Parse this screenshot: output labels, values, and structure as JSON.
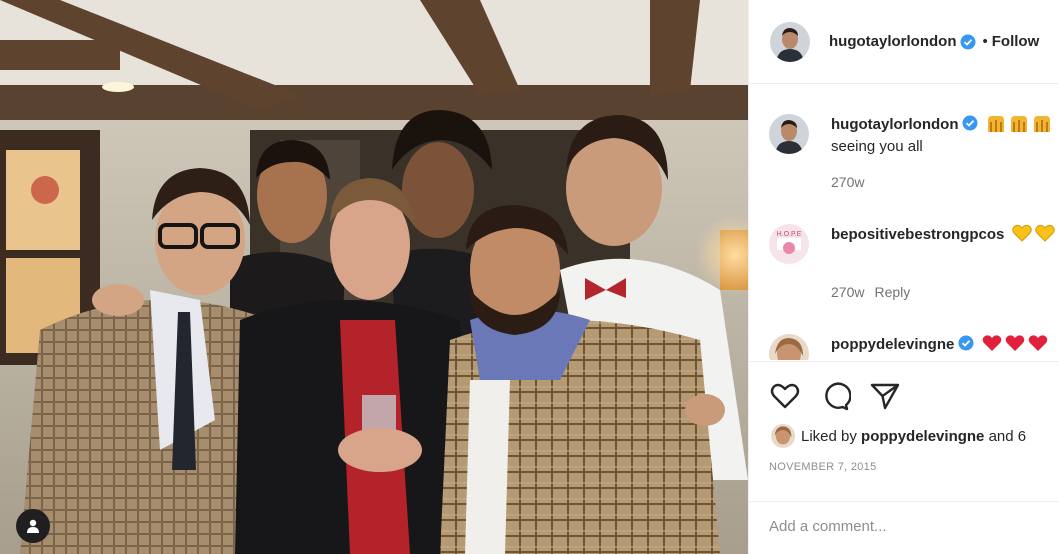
{
  "post": {
    "author": "hugotaylorlondon",
    "follow_label": "Follow",
    "separator": "•"
  },
  "comments": [
    {
      "user": "hugotaylorlondon",
      "verified": true,
      "emojis": [
        "hands-icon",
        "hands-icon",
        "hands-icon"
      ],
      "text": "seeing you all",
      "time": "270w",
      "reply": ""
    },
    {
      "user": "bepositivebestrongpcos",
      "verified": false,
      "emojis": [
        "yellow-heart-icon",
        "yellow-heart-icon"
      ],
      "text": "",
      "time": "270w",
      "reply": "Reply"
    },
    {
      "user": "poppydelevingne",
      "verified": true,
      "emojis": [
        "red-heart-icon",
        "red-heart-icon",
        "red-heart-icon"
      ],
      "text": "",
      "time": "",
      "reply": ""
    }
  ],
  "likes": {
    "prefix": "Liked by",
    "user": "poppydelevingne",
    "suffix": "and 6"
  },
  "date": "NOVEMBER 7, 2015",
  "add_comment_placeholder": "Add a comment...",
  "icons": {
    "like": "heart-icon",
    "comment": "comment-icon",
    "share": "send-icon",
    "tag": "user-tag-icon"
  },
  "colors": {
    "verified": "#3897f0",
    "yellow_heart": "#f7c21a",
    "red_heart": "#e0203c",
    "border": "#efefef",
    "muted": "#737373"
  }
}
